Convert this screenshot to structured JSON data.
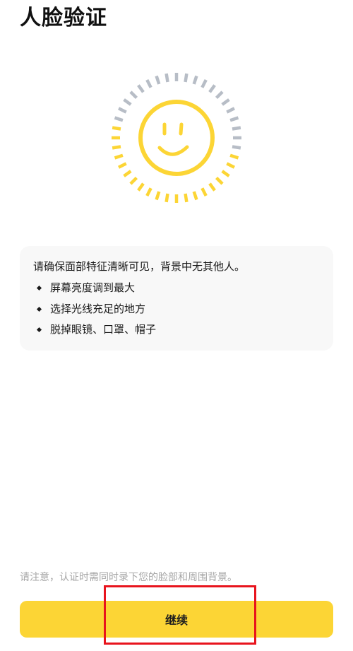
{
  "page": {
    "title": "人脸验证"
  },
  "illustration": {
    "icon": "smiling-face-icon",
    "ring_progress": 0.5,
    "colors": {
      "accent": "#fcd535",
      "inactive": "#b7bdc6"
    }
  },
  "tips": {
    "intro": "请确保面部特征清晰可见，背景中无其他人。",
    "items": [
      "屏幕亮度调到最大",
      "选择光线充足的地方",
      "脱掉眼镜、口罩、帽子"
    ]
  },
  "footer": {
    "notice": "请注意，认证时需同时录下您的脸部和周围背景。",
    "continue_label": "继续"
  },
  "colors": {
    "primary_button": "#fcd535",
    "card_background": "#f8f8f8",
    "highlight": "#e8141d",
    "notice_text": "#a6a6a6"
  }
}
